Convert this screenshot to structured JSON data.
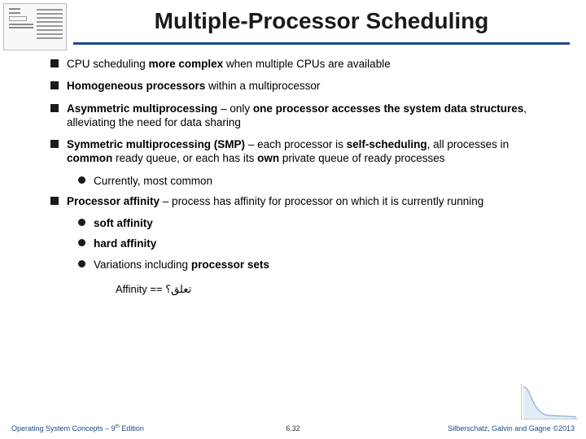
{
  "title": "Multiple-Processor Scheduling",
  "bullets": {
    "b1": {
      "p1": "CPU scheduling ",
      "p2": "more complex",
      "p3": " when multiple CPUs are available"
    },
    "b2": {
      "p1": "Homogeneous processors",
      "p2": " within a multiprocessor"
    },
    "b3": {
      "p1": "Asymmetric multiprocessing",
      "p2": " – only ",
      "p3": "one processor accesses the system data structures",
      "p4": ", alleviating the need for data sharing"
    },
    "b4": {
      "p1": "Symmetric multiprocessing (SMP)",
      "p2": " – each processor is ",
      "p3": "self-scheduling",
      "p4": ", all processes in ",
      "p5": "common",
      "p6": " ready queue, or each has its ",
      "p7": "own",
      "p8": " private queue of ready processes"
    },
    "b4s1": "Currently, most common",
    "b5": {
      "p1": "Processor affinity",
      "p2": " – process has affinity for processor on which it is currently running"
    },
    "b5s1": "soft affinity",
    "b5s2": "hard affinity",
    "b5s3": {
      "p1": "Variations including ",
      "p2": "processor sets"
    }
  },
  "note": "Affinity == تعلق؟",
  "footer": {
    "left_pre": "Operating System Concepts – 9",
    "left_sup": "th",
    "left_post": " Edition",
    "center": "6.32",
    "right_pre": "Silberschatz, Galvin and Gagne ",
    "right_post": "2013",
    "copy": "©"
  }
}
